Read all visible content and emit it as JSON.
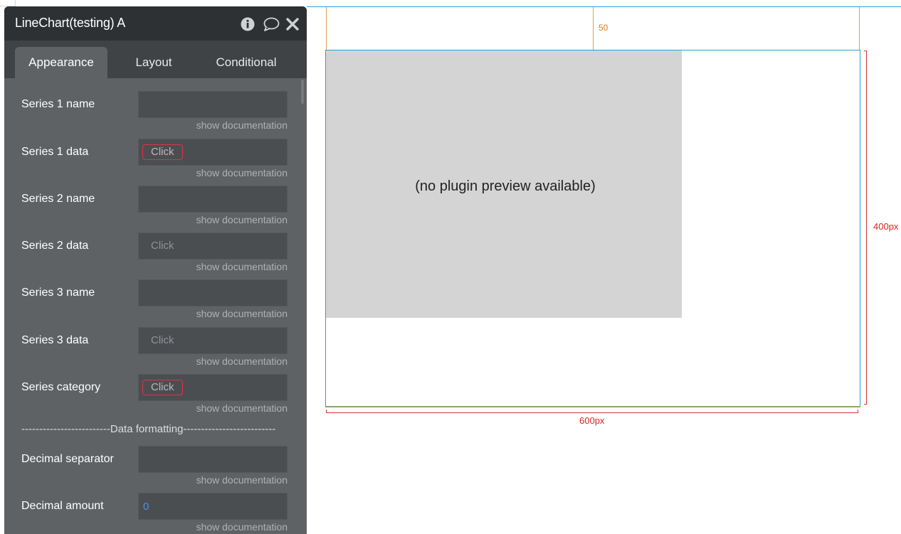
{
  "panel": {
    "title": "LineChart(testing) A",
    "icons": [
      "info-icon",
      "comment-icon",
      "close-icon"
    ],
    "tabs": [
      {
        "label": "Appearance",
        "active": true
      },
      {
        "label": "Layout",
        "active": false
      },
      {
        "label": "Conditional",
        "active": false
      }
    ],
    "doc_link": "show documentation",
    "rows": [
      {
        "label": "Series 1 name",
        "type": "text",
        "value": ""
      },
      {
        "label": "Series 1 data",
        "type": "click",
        "button": "Click",
        "alert": true
      },
      {
        "label": "Series 2 name",
        "type": "text",
        "value": ""
      },
      {
        "label": "Series 2 data",
        "type": "click",
        "button": "Click",
        "alert": false
      },
      {
        "label": "Series 3 name",
        "type": "text",
        "value": ""
      },
      {
        "label": "Series 3 data",
        "type": "click",
        "button": "Click",
        "alert": false
      },
      {
        "label": "Series category",
        "type": "click",
        "button": "Click",
        "alert": true
      }
    ],
    "divider": "-------------------------Data formatting--------------------------",
    "format_rows": [
      {
        "label": "Decimal separator",
        "type": "text",
        "value": ""
      },
      {
        "label": "Decimal amount",
        "type": "number",
        "value": "0"
      }
    ]
  },
  "canvas": {
    "margin_label": "50",
    "preview_text": "(no plugin preview available)",
    "height_label": "400px",
    "width_label": "600px"
  },
  "colors": {
    "panel_bg": "#5f6265",
    "header_bg": "#2e3133",
    "alert": "#e0324a",
    "guide_blue": "#2e9fd6",
    "guide_orange": "#e5a04a",
    "dimension_red": "#d63333"
  }
}
